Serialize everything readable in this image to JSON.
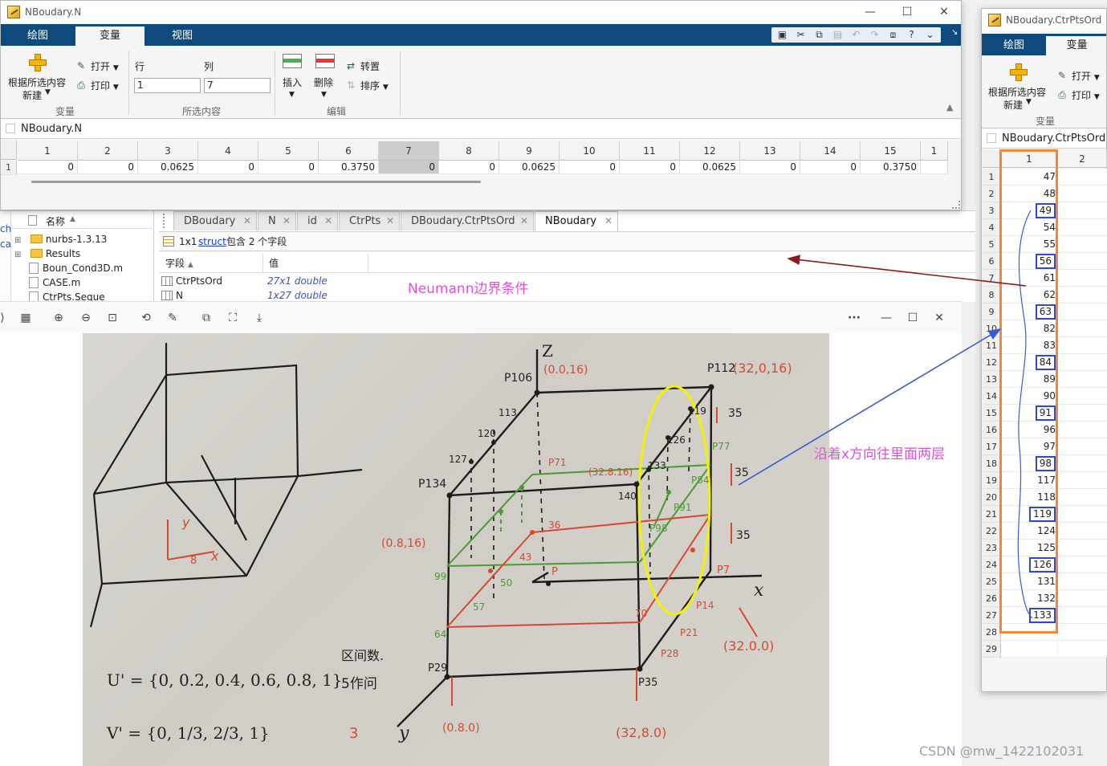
{
  "main_window": {
    "title": "NBoudary.N",
    "tabs": [
      "绘图",
      "变量",
      "视图"
    ],
    "active_tab": "变量",
    "ribbon": {
      "new_from_selection_line1": "根据所选内容",
      "new_from_selection_line2": "新建",
      "open": "打开",
      "print": "打印",
      "section_variable": "变量",
      "row_label": "行",
      "col_label": "列",
      "row_value": "1",
      "col_value": "7",
      "section_selection": "所选内容",
      "insert": "插入",
      "delete": "删除",
      "transpose": "转置",
      "sort": "排序",
      "section_edit": "编辑"
    },
    "breadcrumb": "NBoudary.N",
    "columns": [
      "1",
      "2",
      "3",
      "4",
      "5",
      "6",
      "7",
      "8",
      "9",
      "10",
      "11",
      "12",
      "13",
      "14",
      "15",
      "1"
    ],
    "row_header": "1",
    "values": [
      "0",
      "0",
      "0.0625",
      "0",
      "0",
      "0.3750",
      "0",
      "0",
      "0.0625",
      "0",
      "0",
      "0.0625",
      "0",
      "0",
      "0.3750",
      ""
    ],
    "selected_column": "7"
  },
  "workspace": {
    "file_header": "名称",
    "files": [
      {
        "name": "nurbs-1.3.13",
        "type": "folder"
      },
      {
        "name": "Results",
        "type": "folder"
      },
      {
        "name": "Boun_Cond3D.m",
        "type": "m"
      },
      {
        "name": "CASE.m",
        "type": "m"
      },
      {
        "name": "CtrPts.Seque",
        "type": "m"
      }
    ],
    "left_edge_text": [
      "ch",
      "ca"
    ],
    "editor_tabs": [
      "DBoudary",
      "N",
      "id",
      "CtrPts",
      "DBoudary.CtrPtsOrd",
      "NBoudary"
    ],
    "active_editor_tab": "NBoudary",
    "struct_info_prefix": "1x1",
    "struct_link": "struct",
    "struct_info_suffix": "包含 2 个字段",
    "field_header": "字段",
    "value_header": "值",
    "fields": [
      {
        "name": "CtrPtsOrd",
        "value": "27x1 double"
      },
      {
        "name": "N",
        "value": "1x27 double"
      }
    ]
  },
  "annotations": {
    "neumann": "Neumann边界条件",
    "along_x": "沿着x方向往里面两层"
  },
  "viewer": {
    "toolbar_more": "···"
  },
  "photo": {
    "labels": {
      "z_axis": "Z",
      "x_axis": "x",
      "y_axis": "y",
      "p106": "P106",
      "p106_coord": "(0.0,16)",
      "p112": "P112",
      "p112_coord": "(32,0,16)",
      "p134": "P134",
      "p134_coord": "(0.8,16)",
      "p140": "140",
      "p29": "P29",
      "p29_coord": "(0.8.0)",
      "p35": "P35",
      "p35_coord": "(32,8.0)",
      "p7": "P7",
      "p7_coord": "(32.0.0)",
      "p71": "P71",
      "p77": "P77",
      "p84": "P84",
      "p91": "P91",
      "p98": "P98",
      "p36": "36",
      "p43": "43",
      "p64": "64",
      "p99": "99",
      "p57": "57",
      "p50": "50",
      "p1": "P",
      "p70": "70",
      "p14": "P14",
      "p21": "P21",
      "p28": "P28",
      "p133": "133",
      "p126": "126",
      "p119": "119",
      "p120": "120",
      "p127": "127",
      "p113": "113",
      "p35a": "35",
      "p35b": "35",
      "p35c": "35",
      "mid_coord": "(32.8.16)",
      "u_knots": "U' = {0, 0.2, 0.4, 0.6, 0.8, 1}",
      "u_note": "5作问",
      "u_note2": "区间数.",
      "v_knots": "V' = {0, 1/3, 2/3, 1}",
      "v_count": "3",
      "small_y": "y",
      "small_x": "x",
      "small_8": "8"
    }
  },
  "side_window": {
    "title": "NBoudary.CtrPtsOrd",
    "tabs": [
      "绘图",
      "变量"
    ],
    "active_tab": "变量",
    "ribbon": {
      "new_from_selection_line1": "根据所选内容",
      "new_from_selection_line2": "新建",
      "open": "打开",
      "print": "打印",
      "section_variable": "变量"
    },
    "breadcrumb": "NBoudary.CtrPtsOrd",
    "columns": [
      "1",
      "2"
    ],
    "rows": [
      {
        "row": "1",
        "value": "47",
        "boxed": false
      },
      {
        "row": "2",
        "value": "48",
        "boxed": false
      },
      {
        "row": "3",
        "value": "49",
        "boxed": true
      },
      {
        "row": "4",
        "value": "54",
        "boxed": false
      },
      {
        "row": "5",
        "value": "55",
        "boxed": false
      },
      {
        "row": "6",
        "value": "56",
        "boxed": true
      },
      {
        "row": "7",
        "value": "61",
        "boxed": false
      },
      {
        "row": "8",
        "value": "62",
        "boxed": false
      },
      {
        "row": "9",
        "value": "63",
        "boxed": true
      },
      {
        "row": "10",
        "value": "82",
        "boxed": false
      },
      {
        "row": "11",
        "value": "83",
        "boxed": false
      },
      {
        "row": "12",
        "value": "84",
        "boxed": true
      },
      {
        "row": "13",
        "value": "89",
        "boxed": false
      },
      {
        "row": "14",
        "value": "90",
        "boxed": false
      },
      {
        "row": "15",
        "value": "91",
        "boxed": true
      },
      {
        "row": "16",
        "value": "96",
        "boxed": false
      },
      {
        "row": "17",
        "value": "97",
        "boxed": false
      },
      {
        "row": "18",
        "value": "98",
        "boxed": true
      },
      {
        "row": "19",
        "value": "117",
        "boxed": false
      },
      {
        "row": "20",
        "value": "118",
        "boxed": false
      },
      {
        "row": "21",
        "value": "119",
        "boxed": true
      },
      {
        "row": "22",
        "value": "124",
        "boxed": false
      },
      {
        "row": "23",
        "value": "125",
        "boxed": false
      },
      {
        "row": "24",
        "value": "126",
        "boxed": true
      },
      {
        "row": "25",
        "value": "131",
        "boxed": false
      },
      {
        "row": "26",
        "value": "132",
        "boxed": false
      },
      {
        "row": "27",
        "value": "133",
        "boxed": true
      },
      {
        "row": "28",
        "value": "",
        "boxed": false
      },
      {
        "row": "29",
        "value": "",
        "boxed": false
      }
    ]
  },
  "watermark": "CSDN @mw_1422102031",
  "colors": {
    "ribbon_blue": "#0e4a7c",
    "annotation_magenta": "#e04fd6",
    "highlight_box_blue": "#2f4bc4",
    "orange_frame": "#f0883a",
    "yellow_ellipse": "#f2f200",
    "arrow_darkred": "#8b1a1a",
    "arrow_blue": "#3a5bd0"
  }
}
